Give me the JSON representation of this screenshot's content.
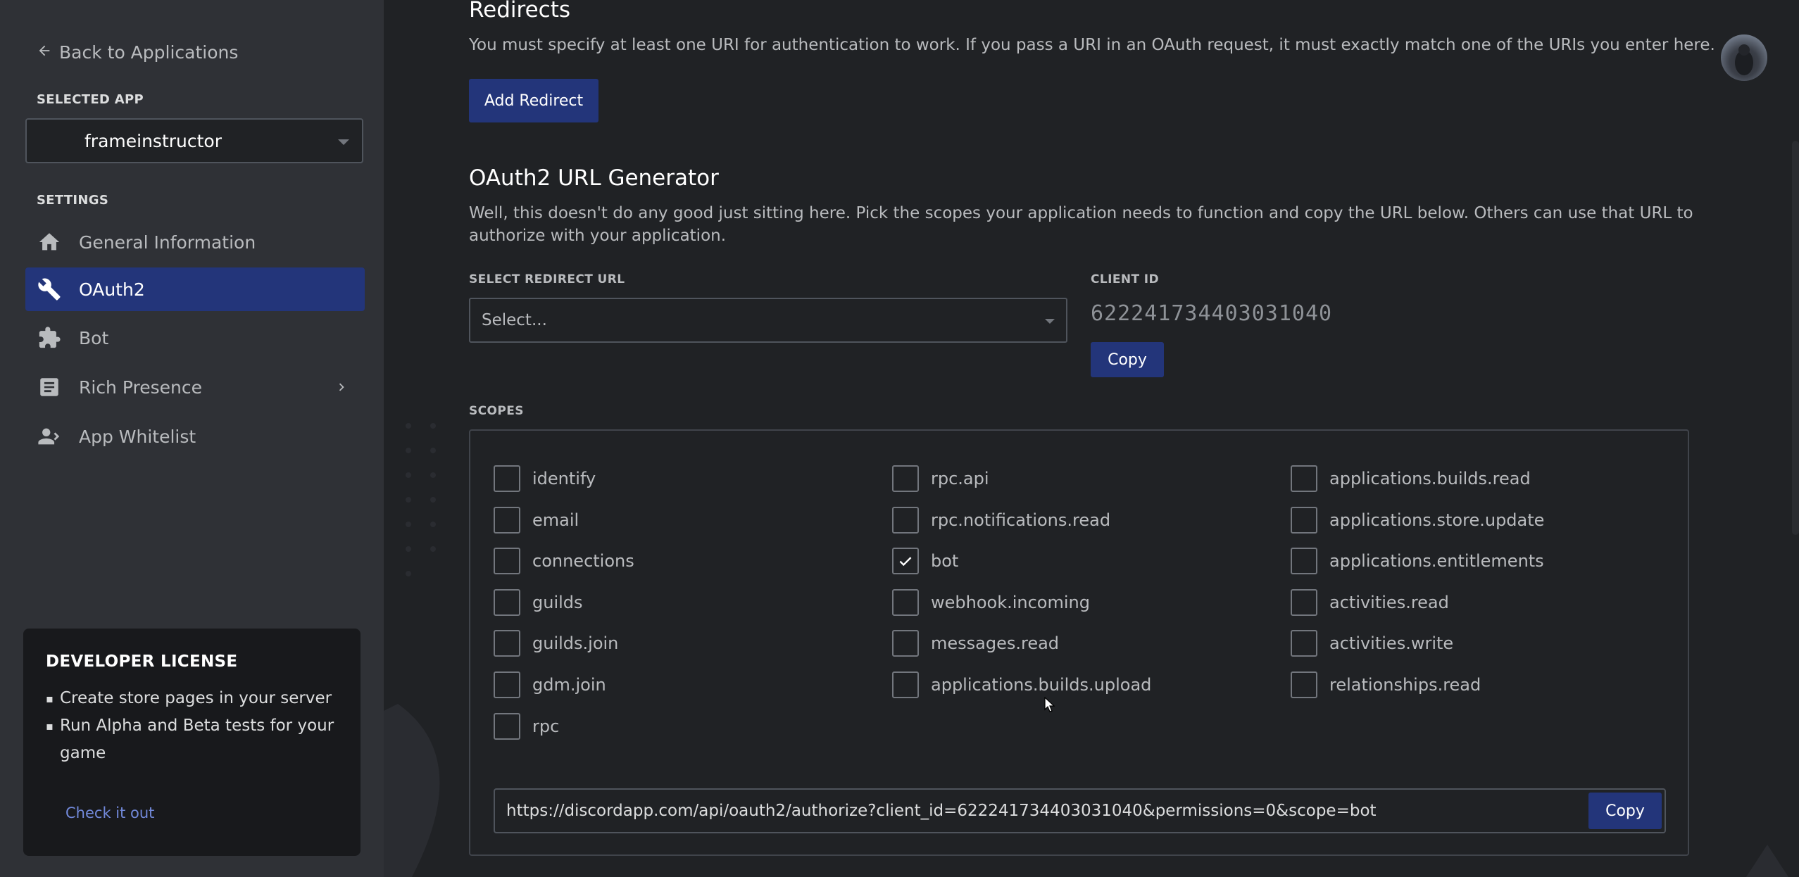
{
  "sidebar": {
    "back_label": "Back to Applications",
    "selected_app_heading": "SELECTED APP",
    "selected_app": "frameinstructor",
    "settings_heading": "SETTINGS",
    "items": [
      {
        "label": "General Information",
        "icon": "home-icon"
      },
      {
        "label": "OAuth2",
        "icon": "wrench-icon",
        "active": true
      },
      {
        "label": "Bot",
        "icon": "puzzle-icon"
      },
      {
        "label": "Rich Presence",
        "icon": "document-icon"
      },
      {
        "label": "App Whitelist",
        "icon": "person-icon"
      }
    ],
    "license": {
      "title": "DEVELOPER LICENSE",
      "bullets": [
        "Create store pages in your server",
        "Run Alpha and Beta tests for your game"
      ],
      "link": "Check it out"
    }
  },
  "redirects": {
    "title": "Redirects",
    "description": "You must specify at least one URI for authentication to work. If you pass a URI in an OAuth request, it must exactly match one of the URIs you enter here.",
    "add_button": "Add Redirect"
  },
  "generator": {
    "title": "OAuth2 URL Generator",
    "description": "Well, this doesn't do any good just sitting here. Pick the scopes your application needs to function and copy the URL below. Others can use that URL to authorize with your application.",
    "redirect_label": "SELECT REDIRECT URL",
    "redirect_placeholder": "Select...",
    "client_id_label": "CLIENT ID",
    "client_id": "622241734403031040",
    "copy_label": "Copy",
    "scopes_label": "SCOPES",
    "scopes": [
      [
        "identify",
        "email",
        "connections",
        "guilds",
        "guilds.join",
        "gdm.join",
        "rpc"
      ],
      [
        "rpc.api",
        "rpc.notifications.read",
        "bot",
        "webhook.incoming",
        "messages.read",
        "applications.builds.upload"
      ],
      [
        "applications.builds.read",
        "applications.store.update",
        "applications.entitlements",
        "activities.read",
        "activities.write",
        "relationships.read"
      ]
    ],
    "checked": [
      "bot"
    ],
    "generated_url": "https://discordapp.com/api/oauth2/authorize?client_id=622241734403031040&permissions=0&scope=bot",
    "url_copy_label": "Copy"
  },
  "colors": {
    "accent": "#23357a",
    "sidebar_bg": "#2f3136",
    "main_bg": "#202225"
  }
}
